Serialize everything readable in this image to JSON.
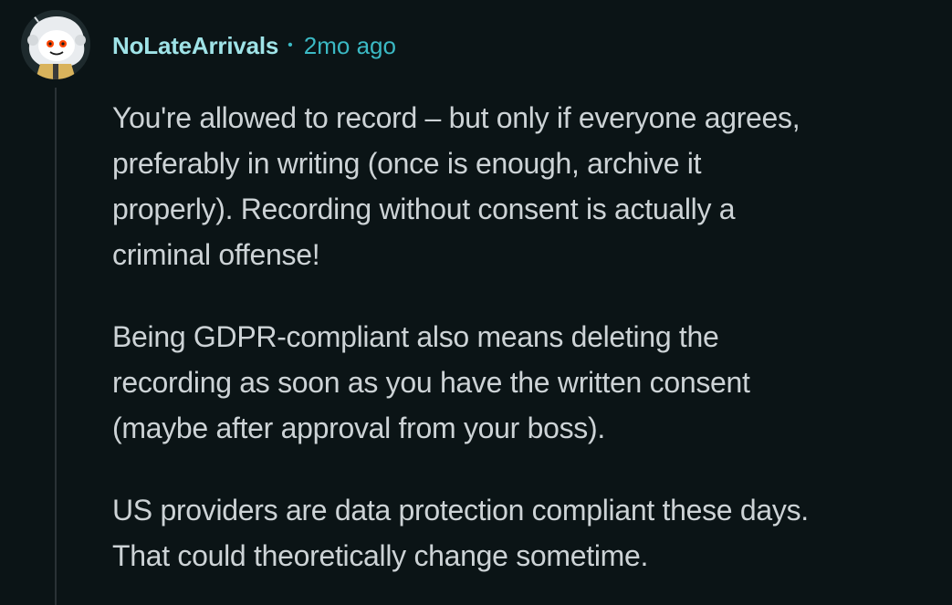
{
  "comment": {
    "username": "NoLateArrivals",
    "separator": "•",
    "timestamp": "2mo ago",
    "paragraphs": [
      {
        "lines": [
          "You're allowed to record – but only if everyone agrees,",
          "preferably in writing (once is enough, archive it",
          "properly). Recording without consent is actually a",
          "criminal offense!"
        ]
      },
      {
        "lines": [
          "Being GDPR-compliant also means deleting the",
          "recording as soon as you have the written consent",
          "(maybe after approval from your boss)."
        ]
      },
      {
        "lines": [
          "US providers are data protection compliant these days.",
          "That could theoretically change sometime."
        ]
      }
    ]
  },
  "colors": {
    "background": "#0b1416",
    "username": "#9fe3e7",
    "timestamp": "#3bb9c4",
    "body_text": "#cdd3d6",
    "thread_line": "#2a3236"
  },
  "icons": {
    "avatar": "snoo-avatar-icon"
  }
}
